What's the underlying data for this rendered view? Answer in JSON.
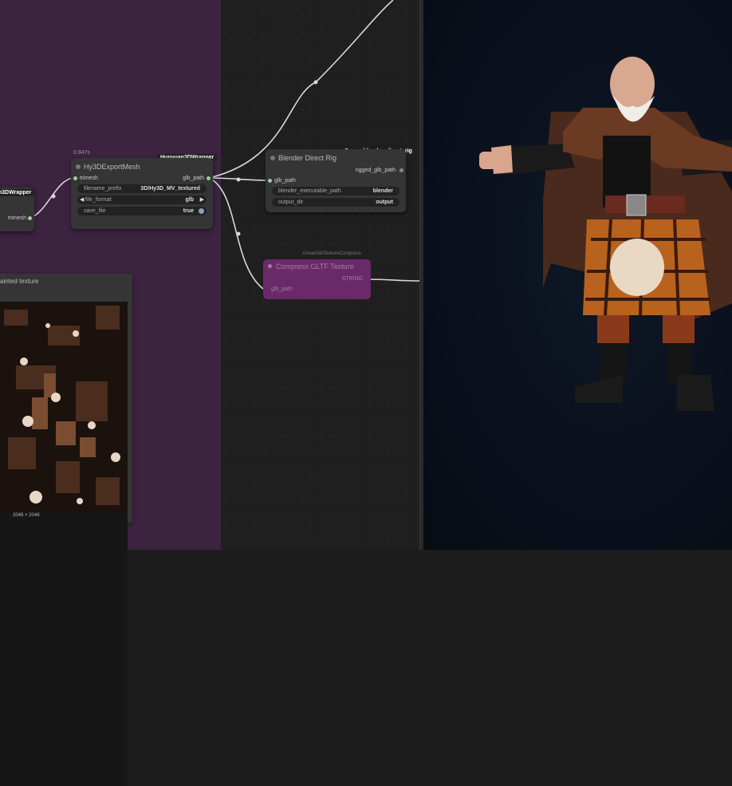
{
  "colors": {
    "group": "#3c2340",
    "canvas": "#1f1f1f",
    "viewer": "#0a101c",
    "node": "#353535",
    "purple_node": "#6a2a6a"
  },
  "export_node": {
    "timing": "0.847s",
    "badge": "Hunyuan3DWrapper",
    "title": "Hy3DExportMesh",
    "input": "trimesh",
    "output": "glb_path",
    "widgets": [
      {
        "label": "filename_prefix",
        "value": "3D/Hy3D_MV_textured"
      },
      {
        "label": "file_format",
        "value": "glb"
      },
      {
        "label": "save_file",
        "value": "true"
      }
    ]
  },
  "left_node": {
    "badge": "an3DWrapper",
    "output": "trimesh"
  },
  "rig_node": {
    "badge": "Gman_blender_direct_rig",
    "title": "Blender Direct Rig",
    "input": "glb_path",
    "output": "rigged_glb_path",
    "widgets": [
      {
        "label": "blender_executable_path",
        "value": "blender"
      },
      {
        "label": "output_dir",
        "value": "output"
      }
    ]
  },
  "compress_node": {
    "badge": "GmanGlbTextureCompress",
    "title": "Compress GLTF Texture",
    "input": "glb_path",
    "output": "STRING"
  },
  "preview_node": {
    "title": "ainted texture",
    "size": "2048 × 2048"
  },
  "viewer": {
    "label": "3D model viewer"
  }
}
